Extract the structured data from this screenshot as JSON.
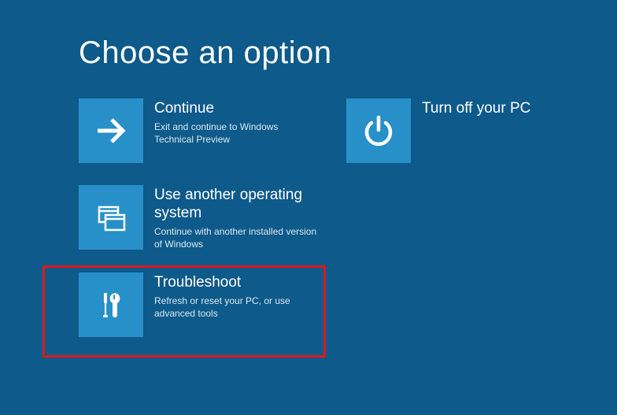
{
  "title": "Choose an option",
  "colors": {
    "background": "#0e5a8a",
    "tile": "#2890c8",
    "highlight": "#e01818"
  },
  "options": {
    "continue": {
      "title": "Continue",
      "desc": "Exit and continue to Windows Technical Preview"
    },
    "another_os": {
      "title": "Use another operating system",
      "desc": "Continue with another installed version of Windows"
    },
    "troubleshoot": {
      "title": "Troubleshoot",
      "desc": "Refresh or reset your PC, or use advanced tools"
    },
    "turn_off": {
      "title": "Turn off your PC",
      "desc": ""
    }
  }
}
